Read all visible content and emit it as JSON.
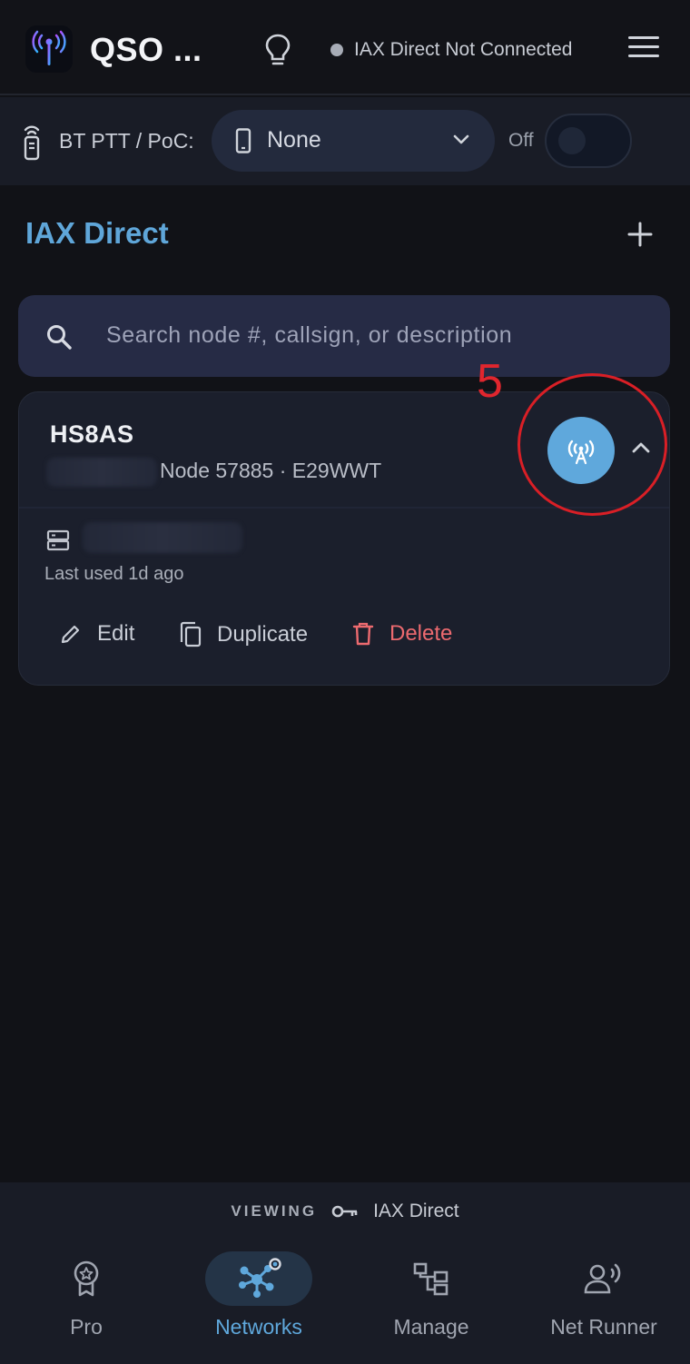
{
  "header": {
    "app_title": "QSO ...",
    "connection_status": "IAX Direct Not Connected"
  },
  "ptt_bar": {
    "label": "BT PTT / PoC:",
    "device_selected": "None",
    "toggle_label": "Off"
  },
  "section": {
    "title": "IAX Direct"
  },
  "search": {
    "placeholder": "Search node #, callsign, or description"
  },
  "node_card": {
    "callsign": "HS8AS",
    "node_info": "Node 57885 · E29WWT",
    "last_used": "Last used 1d ago",
    "actions": {
      "edit": "Edit",
      "duplicate": "Duplicate",
      "delete": "Delete"
    }
  },
  "annotation": {
    "number": "5"
  },
  "bottom": {
    "viewing_label": "VIEWING",
    "viewing_network": "IAX Direct",
    "nav": [
      {
        "label": "Pro",
        "icon": "award-icon"
      },
      {
        "label": "Networks",
        "icon": "network-icon",
        "active": true
      },
      {
        "label": "Manage",
        "icon": "hierarchy-icon"
      },
      {
        "label": "Net Runner",
        "icon": "voice-user-icon"
      }
    ]
  },
  "colors": {
    "accent": "#5fa8dc",
    "delete": "#ec6a6f",
    "annotation": "#d91f26"
  }
}
